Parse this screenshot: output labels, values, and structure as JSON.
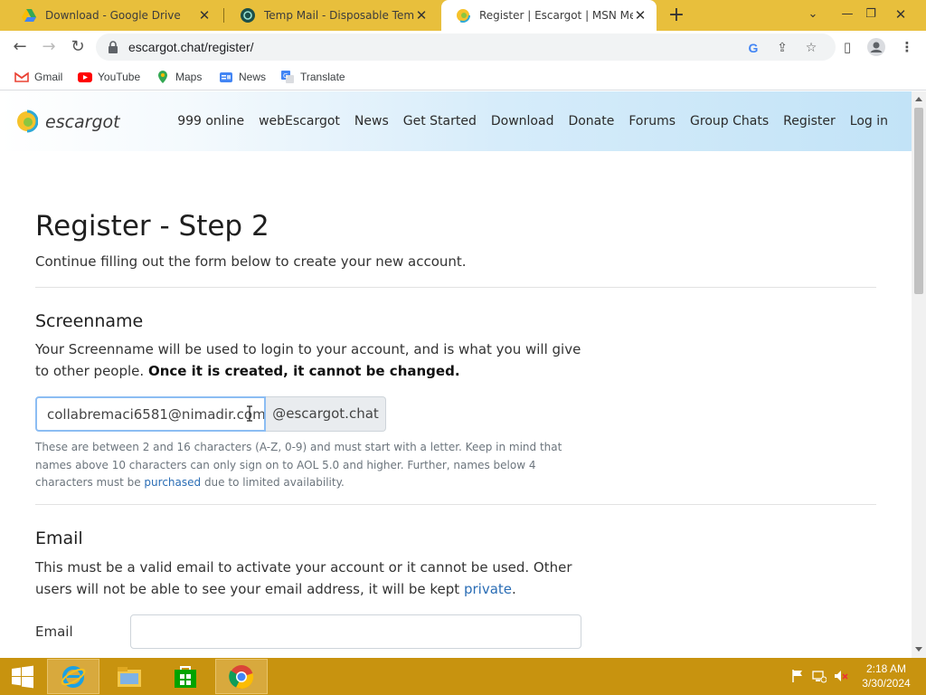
{
  "browser": {
    "tabs": [
      {
        "title": "Download - Google Drive",
        "favicon": "google-drive-icon"
      },
      {
        "title": "Temp Mail - Disposable Tempora",
        "favicon": "temp-mail-icon"
      },
      {
        "title": "Register | Escargot | MSN Messen",
        "favicon": "escargot-icon",
        "active": true
      }
    ],
    "url": "escargot.chat/register/",
    "bookmarks": [
      {
        "label": "Gmail",
        "icon": "gmail-icon"
      },
      {
        "label": "YouTube",
        "icon": "youtube-icon"
      },
      {
        "label": "Maps",
        "icon": "maps-icon"
      },
      {
        "label": "News",
        "icon": "news-icon"
      },
      {
        "label": "Translate",
        "icon": "translate-icon"
      }
    ]
  },
  "site": {
    "logo_text": "escargot",
    "nav": [
      "999 online",
      "webEscargot",
      "News",
      "Get Started",
      "Download",
      "Donate",
      "Forums",
      "Group Chats",
      "Register",
      "Log in"
    ]
  },
  "page": {
    "title": "Register - Step 2",
    "lead": "Continue filling out the form below to create your new account.",
    "screenname": {
      "heading": "Screenname",
      "desc_1": "Your Screenname will be used to login to your account, and is what you will give to other people. ",
      "desc_bold": "Once it is created, it cannot be changed.",
      "input_value": "collabremaci6581@nimadir.com",
      "suffix": "@escargot.chat",
      "help_1": "These are between 2 and 16 characters (A-Z, 0-9) and must start with a letter. Keep in mind that names above 10 characters can only sign on to AOL 5.0 and higher. Further, names below 4 characters must be ",
      "help_link": "purchased",
      "help_2": " due to limited availability."
    },
    "email": {
      "heading": "Email",
      "desc_1": "This must be a valid email to activate your account or it cannot be used. Other users will not be able to see your email address, it will be kept ",
      "desc_link": "private",
      "desc_2": ".",
      "label": "Email",
      "value": ""
    }
  },
  "taskbar": {
    "time": "2:18 AM",
    "date": "3/30/2024",
    "apps": [
      "start-icon",
      "internet-explorer-icon",
      "file-explorer-icon",
      "store-icon",
      "chrome-icon"
    ]
  },
  "colors": {
    "tab_strip": "#e8bf3c",
    "taskbar": "#c8930f",
    "link": "#2a6db5",
    "input_focus": "#8cbdf3"
  }
}
